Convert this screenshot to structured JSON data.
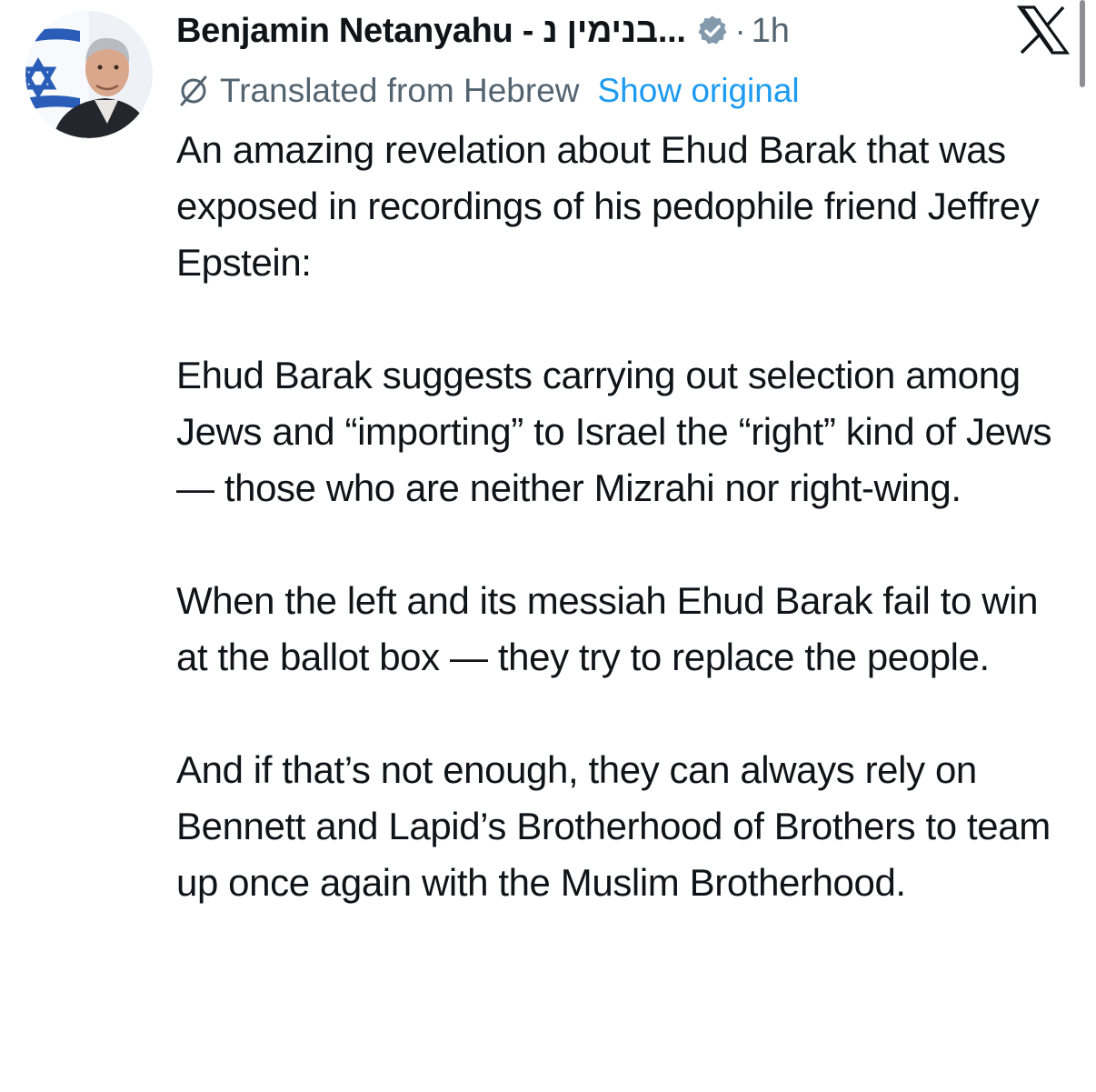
{
  "author": {
    "display_name": "Benjamin Netanyahu - בנימין נ...",
    "time_separator": "·",
    "timestamp": "1h",
    "avatar_icon": "avatar-portrait",
    "verified_icon": "verified-badge-icon",
    "verified_color": "#829aab"
  },
  "translation": {
    "label": "Translated from Hebrew",
    "show_original": "Show original",
    "icon": "translate-icon",
    "link_color": "#1d9bf0"
  },
  "tweet": {
    "paragraphs": [
      "An amazing revelation about Ehud Barak that was exposed in recordings of his pedophile friend Jeffrey Epstein:",
      "Ehud Barak suggests carrying out selection among Jews and “importing” to Israel the “right” kind of Jews — those who are neither Mizrahi nor right-wing.",
      "When the left and its messiah Ehud Barak fail to win at the ballot box — they try to replace the people.",
      "And if that’s not enough, they can always rely on Bennett and Lapid’s Brotherhood of Brothers to team up once again with the Muslim Brotherhood."
    ]
  },
  "app": {
    "brand_icon": "x-logo-icon"
  }
}
